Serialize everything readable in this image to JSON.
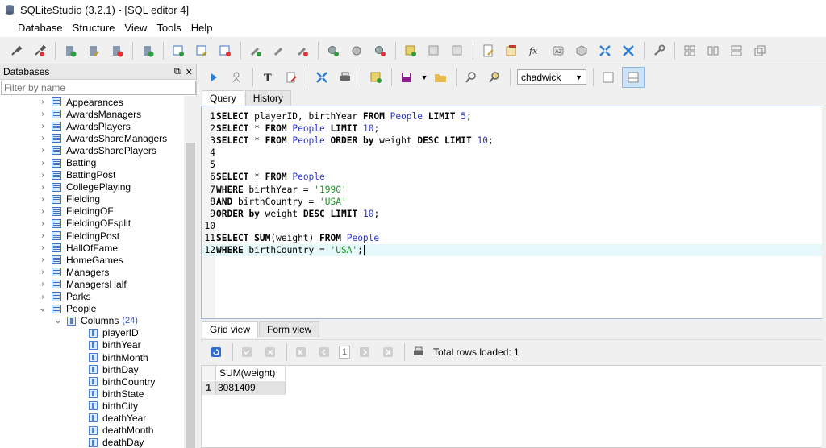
{
  "window": {
    "title": "SQLiteStudio (3.2.1) - [SQL editor 4]"
  },
  "menu": [
    "Database",
    "Structure",
    "View",
    "Tools",
    "Help"
  ],
  "toolbar_icons": [
    "connect-icon",
    "disconnect-icon",
    "add-db-icon",
    "edit-db-icon",
    "remove-db-icon",
    "refresh-icon",
    "new-table-icon",
    "edit-table-icon",
    "delete-table-icon",
    "new-index-icon",
    "edit-index-icon",
    "delete-index-icon",
    "new-trigger-icon",
    "edit-trigger-icon",
    "delete-trigger-icon",
    "new-view-icon",
    "edit-view-icon",
    "delete-view-icon",
    "sql-editor-icon",
    "ddl-history-icon",
    "function-icon",
    "collation-icon",
    "extension-icon",
    "import-icon",
    "export-icon",
    "settings-icon",
    "tile-icon",
    "cascade-icon",
    "tile-horizontal-icon",
    "close-all-icon"
  ],
  "databases": {
    "title": "Databases",
    "filter_placeholder": "Filter by name",
    "tables": [
      "Appearances",
      "AwardsManagers",
      "AwardsPlayers",
      "AwardsShareManagers",
      "AwardsSharePlayers",
      "Batting",
      "BattingPost",
      "CollegePlaying",
      "Fielding",
      "FieldingOF",
      "FieldingOFsplit",
      "FieldingPost",
      "HallOfFame",
      "HomeGames",
      "Managers",
      "ManagersHalf",
      "Parks"
    ],
    "expanded_table": "People",
    "columns_label": "Columns",
    "columns_count": "(24)",
    "columns": [
      "playerID",
      "birthYear",
      "birthMonth",
      "birthDay",
      "birthCountry",
      "birthState",
      "birthCity",
      "deathYear",
      "deathMonth",
      "deathDay"
    ]
  },
  "editor": {
    "db_selected": "chadwick",
    "tabs": [
      "Query",
      "History"
    ],
    "active_tab": "Query",
    "lines": [
      "SELECT playerID, birthYear FROM People LIMIT 5;",
      "SELECT * FROM People LIMIT 10;",
      "SELECT * FROM People ORDER by weight DESC LIMIT 10;",
      "",
      "",
      "SELECT * FROM People",
      "WHERE birthYear = '1990'",
      "AND birthCountry = 'USA'",
      "ORDER by weight DESC LIMIT 10;",
      "",
      "SELECT SUM(weight) FROM People",
      "WHERE birthCountry = 'USA';"
    ],
    "current_line": 12
  },
  "results": {
    "tabs": [
      "Grid view",
      "Form view"
    ],
    "active_tab": "Grid view",
    "page": "1",
    "status": "Total rows loaded: 1",
    "columns": [
      "SUM(weight)"
    ],
    "rows": [
      [
        "1",
        "3081409"
      ]
    ]
  }
}
